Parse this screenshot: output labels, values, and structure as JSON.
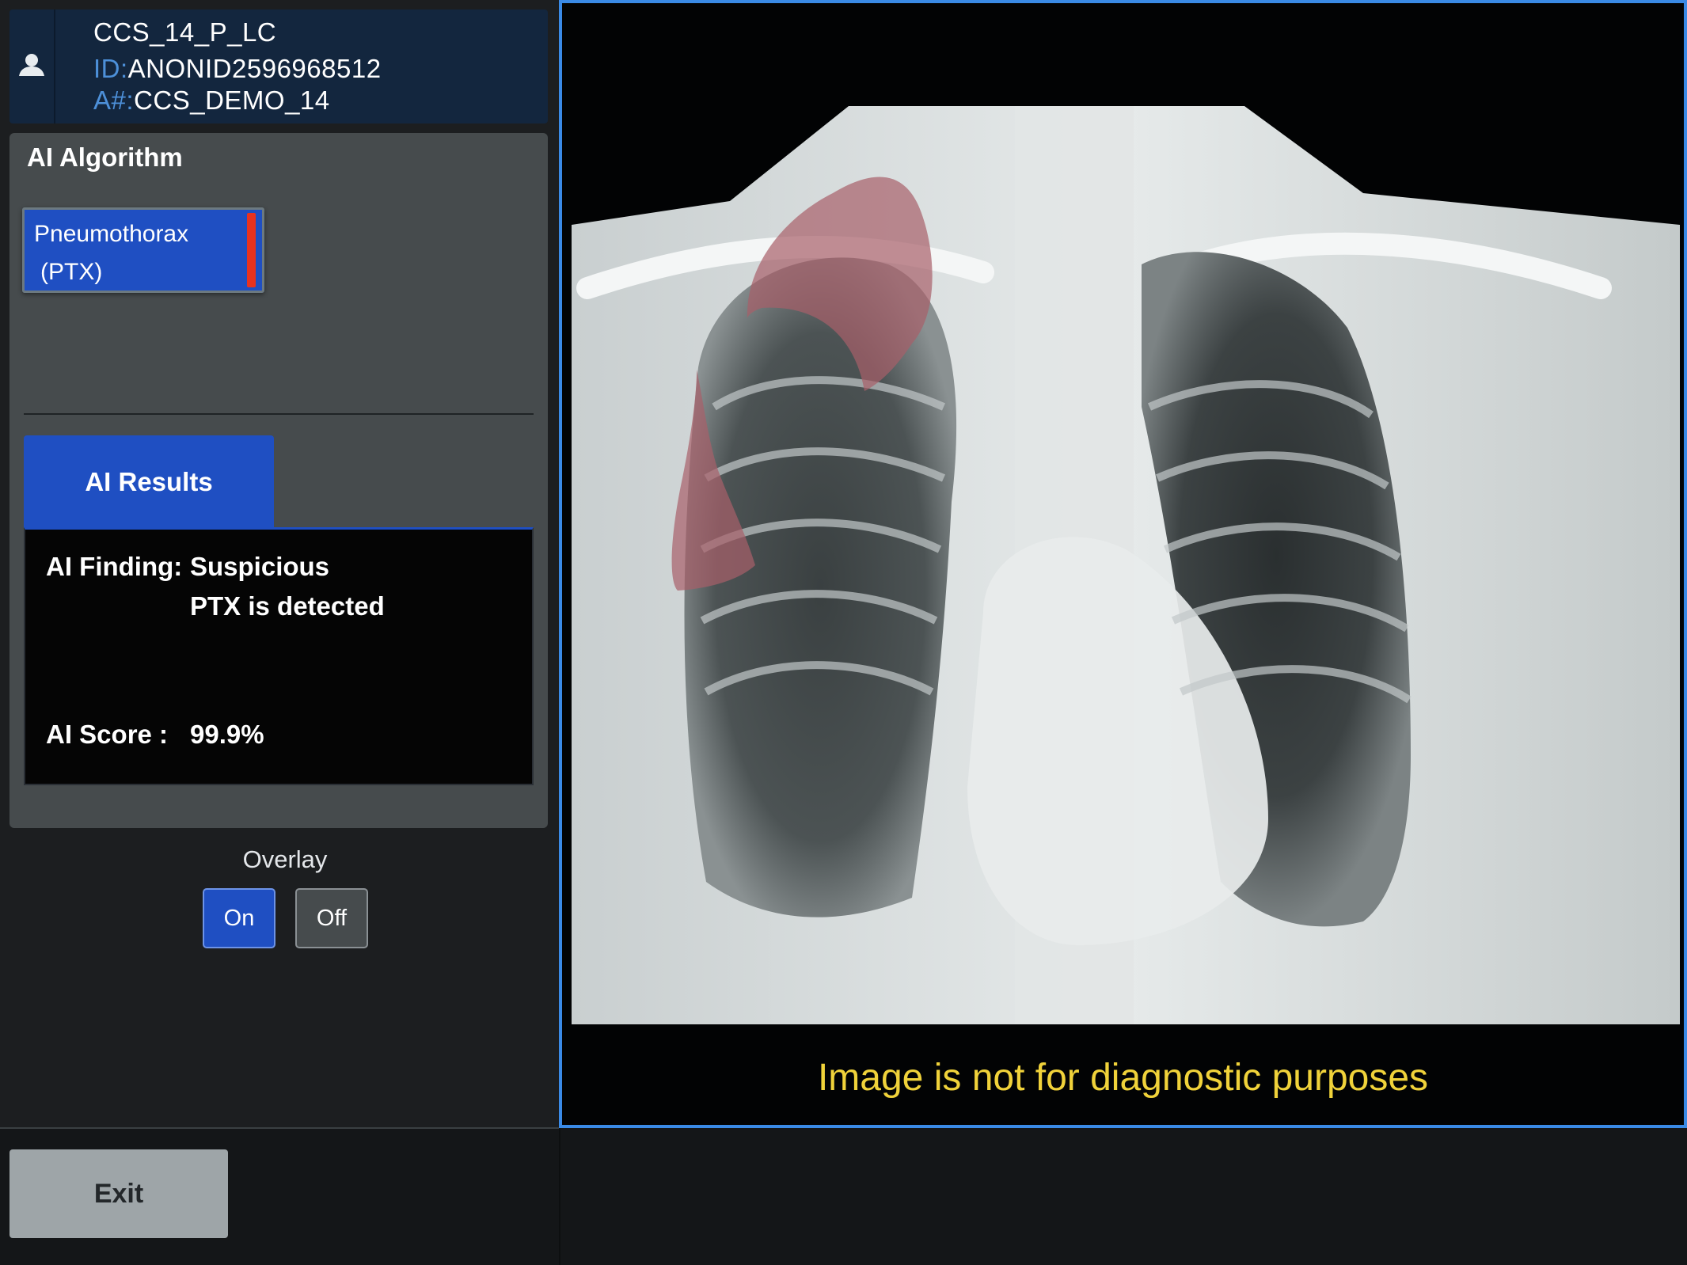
{
  "patient": {
    "name": "CCS_14_P_LC",
    "id_label": "ID:",
    "id_value": "ANONID2596968512",
    "accession_label": "A#:",
    "accession_value": "CCS_DEMO_14"
  },
  "algorithm": {
    "title": "AI Algorithm",
    "button_line1": "Pneumothorax",
    "button_line2": "(PTX)"
  },
  "results": {
    "tab_label": "AI Results",
    "finding_label": "AI Finding:",
    "finding_line1": "Suspicious",
    "finding_line2": "PTX is detected",
    "score_label": "AI Score :",
    "score_value": "99.9%"
  },
  "overlay": {
    "label": "Overlay",
    "on_label": "On",
    "off_label": "Off",
    "selected": "On"
  },
  "footer": {
    "exit_label": "Exit"
  },
  "viewer": {
    "disclaimer": "Image is not for diagnostic purposes"
  },
  "colors": {
    "accent_blue": "#1f4fc2",
    "viewer_border": "#3a8ae6",
    "alert_red": "#e8321f",
    "disclaimer_yellow": "#f0d23a",
    "overlay_mask": "#a8606a"
  }
}
